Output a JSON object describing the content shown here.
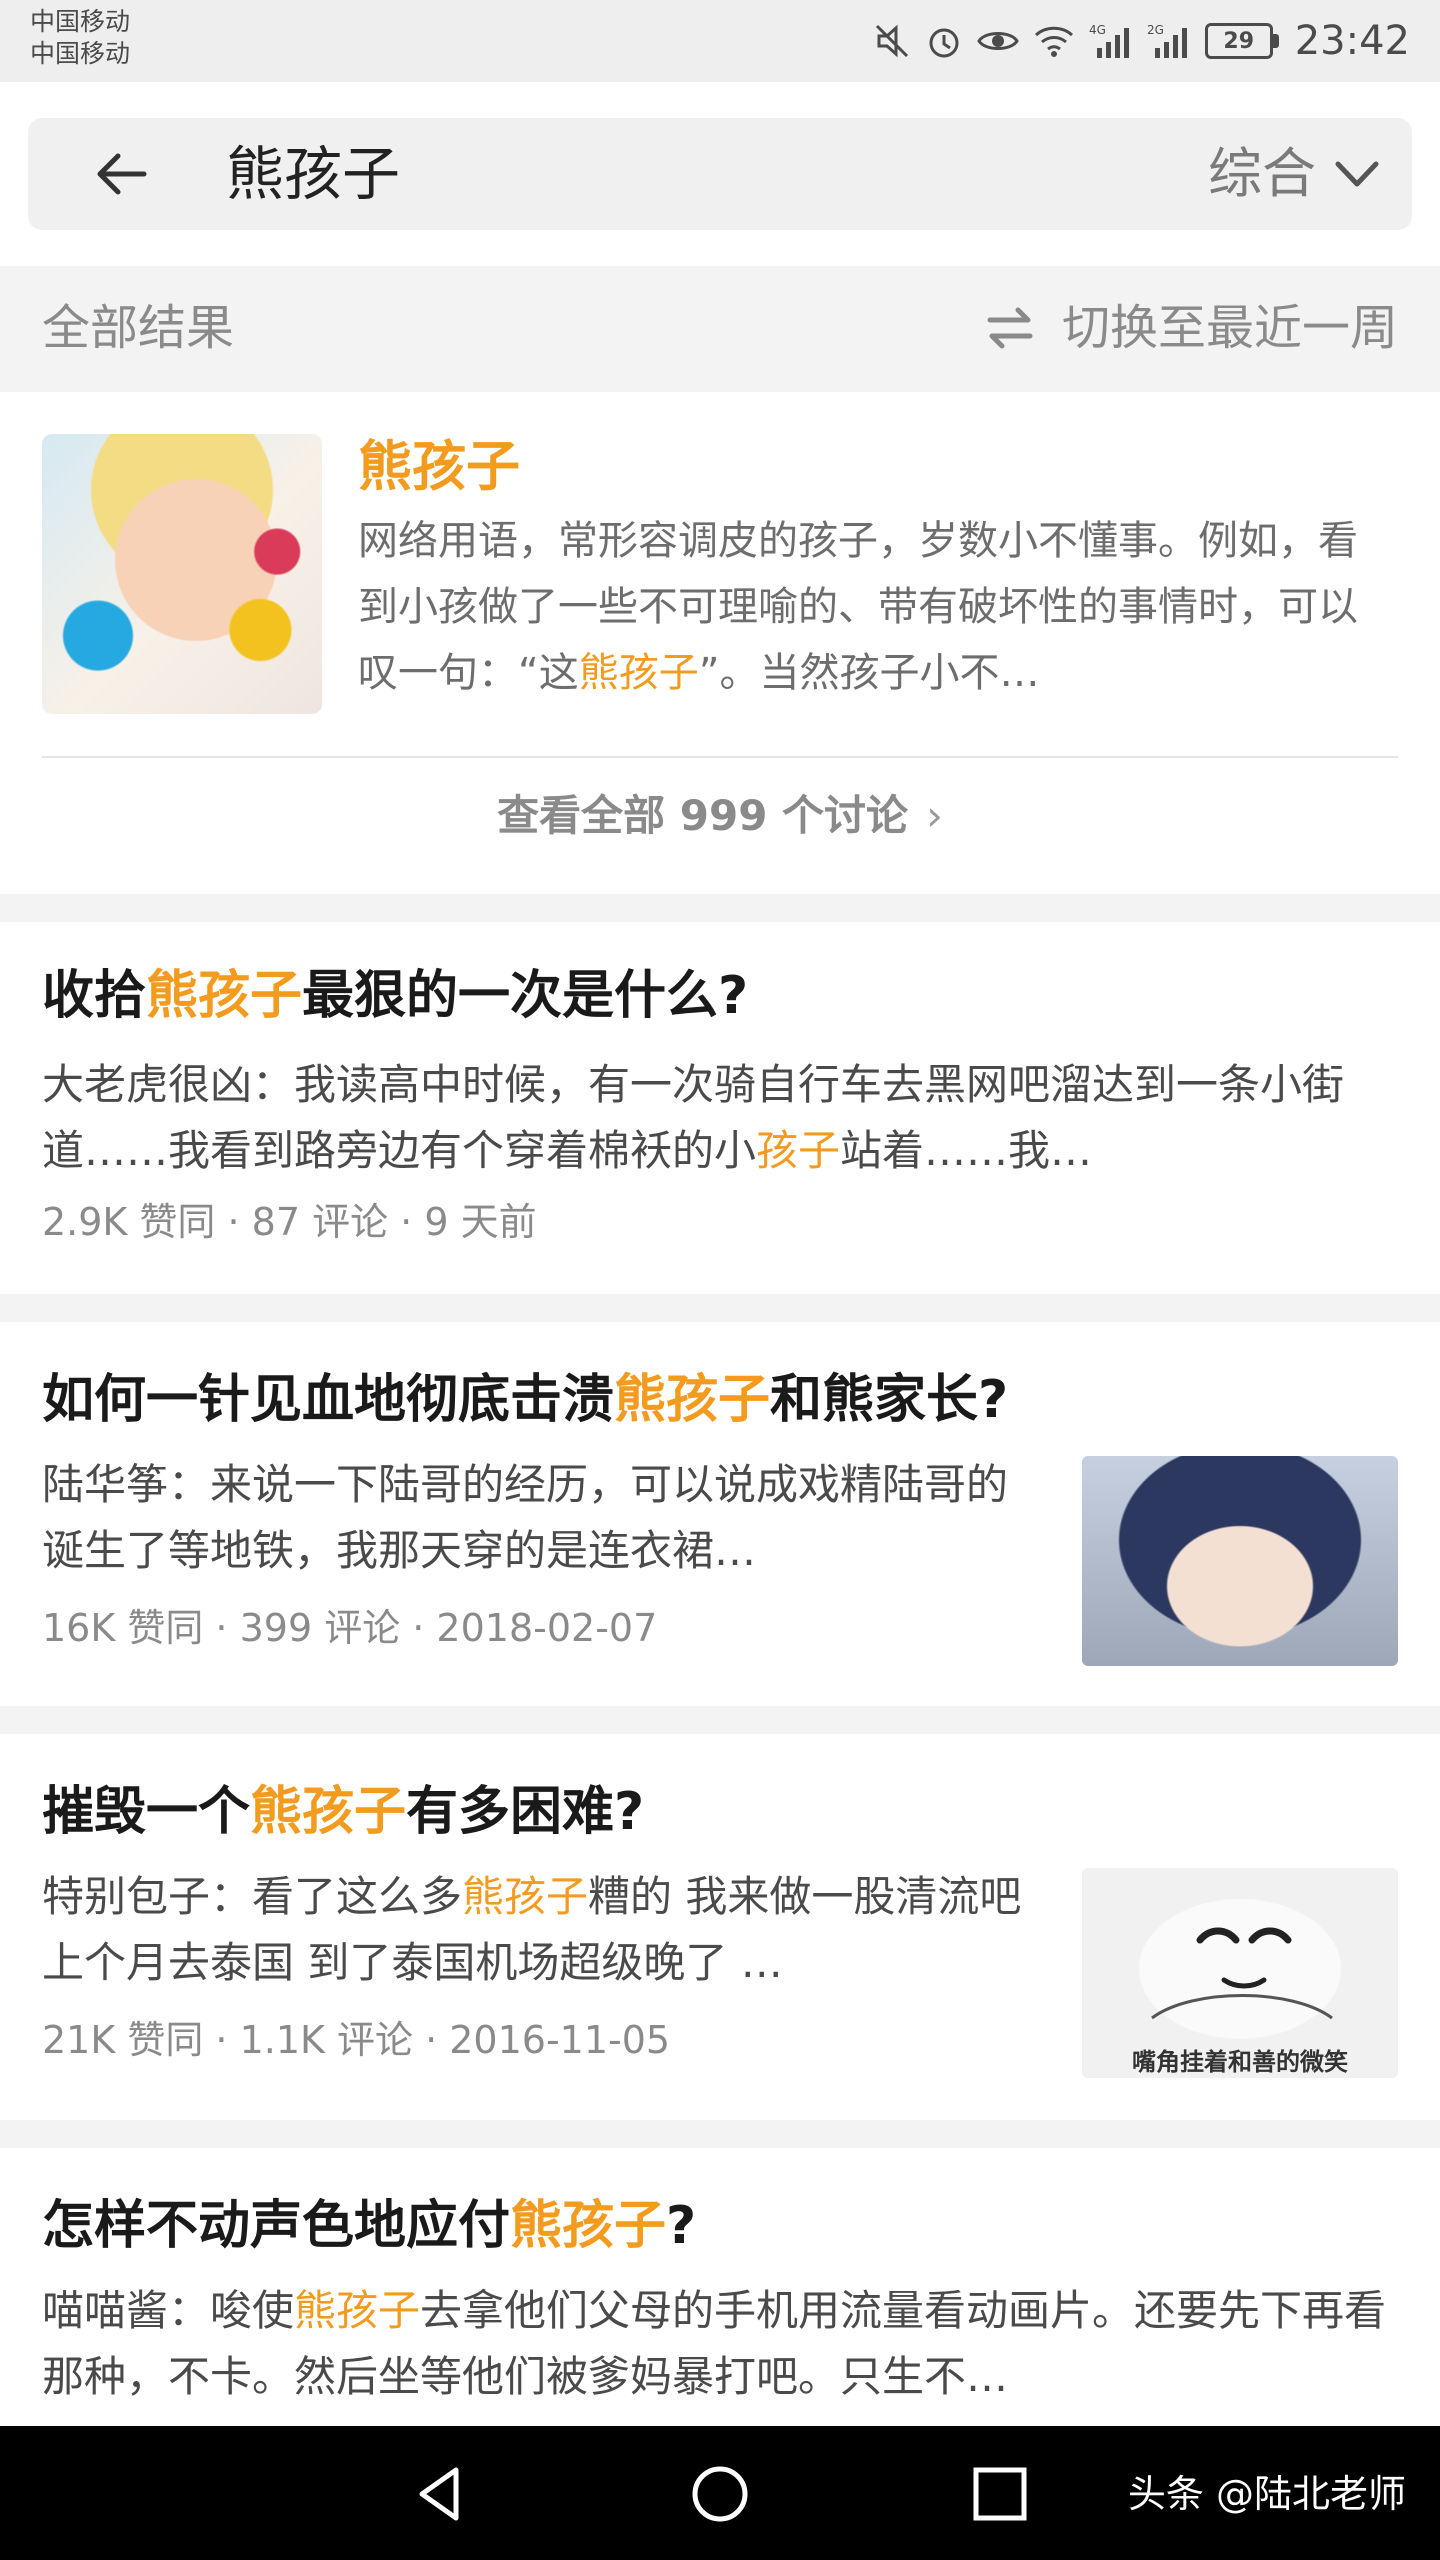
{
  "status_bar": {
    "carrier_1": "中国移动",
    "carrier_2": "中国移动",
    "network_1": "4G",
    "network_2": "2G",
    "battery": "29",
    "time": "23:42",
    "icons": [
      "mute-icon",
      "alarm-icon",
      "eye-icon",
      "wifi-icon",
      "signal-icon",
      "signal-icon",
      "battery-icon"
    ]
  },
  "search": {
    "query": "熊孩子",
    "scope": "综合"
  },
  "results_bar": {
    "label": "全部结果",
    "switch_label": "切换至最近一周"
  },
  "topic": {
    "title": "熊孩子",
    "description_before": "网络用语，常形容调皮的孩子，岁数小不懂事。例如，看到小孩做了一些不可理喻的、带有破坏性的事情时，可以叹一句：“这",
    "description_highlight": "熊孩子",
    "description_after": "”。当然孩子小不…",
    "view_all": "查看全部 999 个讨论",
    "view_all_arrow": "›"
  },
  "results": [
    {
      "title_parts": [
        "收拾",
        "熊孩子",
        "最狠的一次是什么?"
      ],
      "excerpt_parts": [
        "大老虎很凶：我读高中时候，有一次骑自行车去黑网吧溜达到一条小街道……我看到路旁边有个穿着棉袄的小",
        "孩子",
        "站着……我…"
      ],
      "meta": "2.9K 赞同 · 87 评论 · 9 天前"
    },
    {
      "title_parts": [
        "如何一针见血地彻底击溃",
        "熊孩子",
        "和熊家长?"
      ],
      "excerpt_parts": [
        "陆华筝：来说一下陆哥的经历，可以说成戏精陆哥的诞生了等地铁，我那天穿的是连衣裙…",
        "",
        ""
      ],
      "meta": "16K 赞同 · 399 评论 · 2018-02-07"
    },
    {
      "title_parts": [
        "摧毁一个",
        "熊孩子",
        "有多困难?"
      ],
      "excerpt_parts": [
        "特别包子：看了这么多",
        "熊孩子",
        "糟的 我来做一股清流吧上个月去泰国 到了泰国机场超级晚了 …"
      ],
      "meta": "21K 赞同 · 1.1K 评论 · 2016-11-05",
      "thumb_caption": "嘴角挂着和善的微笑"
    },
    {
      "title_parts": [
        "怎样不动声色地应付",
        "熊孩子",
        "?"
      ],
      "excerpt_parts": [
        "喵喵酱：唆使",
        "熊孩子",
        "去拿他们父母的手机用流量看动画片。还要先下再看那种，不卡。然后坐等他们被爹妈暴打吧。只生不…"
      ]
    }
  ],
  "nav": {
    "watermark": "头条 @陆北老师"
  },
  "colors": {
    "highlight": "#f39b1f",
    "background": "#f3f3f3",
    "card": "#ffffff",
    "navbar": "#000000"
  }
}
